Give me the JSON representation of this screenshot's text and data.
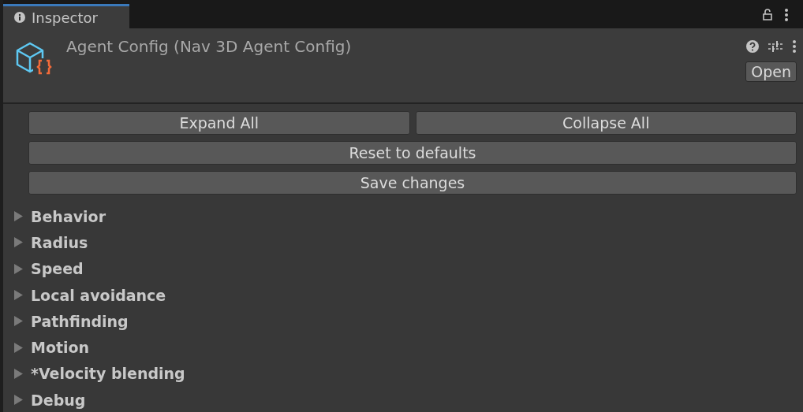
{
  "tab": {
    "label": "Inspector",
    "selected": true
  },
  "header": {
    "title": "Agent Config (Nav 3D Agent Config)",
    "open_button": "Open"
  },
  "buttons": [
    [
      "Expand All",
      "Collapse All"
    ],
    [
      "Reset to defaults"
    ],
    [
      "Save changes"
    ]
  ],
  "sections": [
    {
      "label": "Behavior",
      "expanded": false
    },
    {
      "label": "Radius",
      "expanded": false
    },
    {
      "label": "Speed",
      "expanded": false
    },
    {
      "label": "Local avoidance",
      "expanded": false
    },
    {
      "label": "Pathfinding",
      "expanded": false
    },
    {
      "label": "Motion",
      "expanded": false
    },
    {
      "label": "*Velocity blending",
      "expanded": false
    },
    {
      "label": "Debug",
      "expanded": false
    }
  ]
}
